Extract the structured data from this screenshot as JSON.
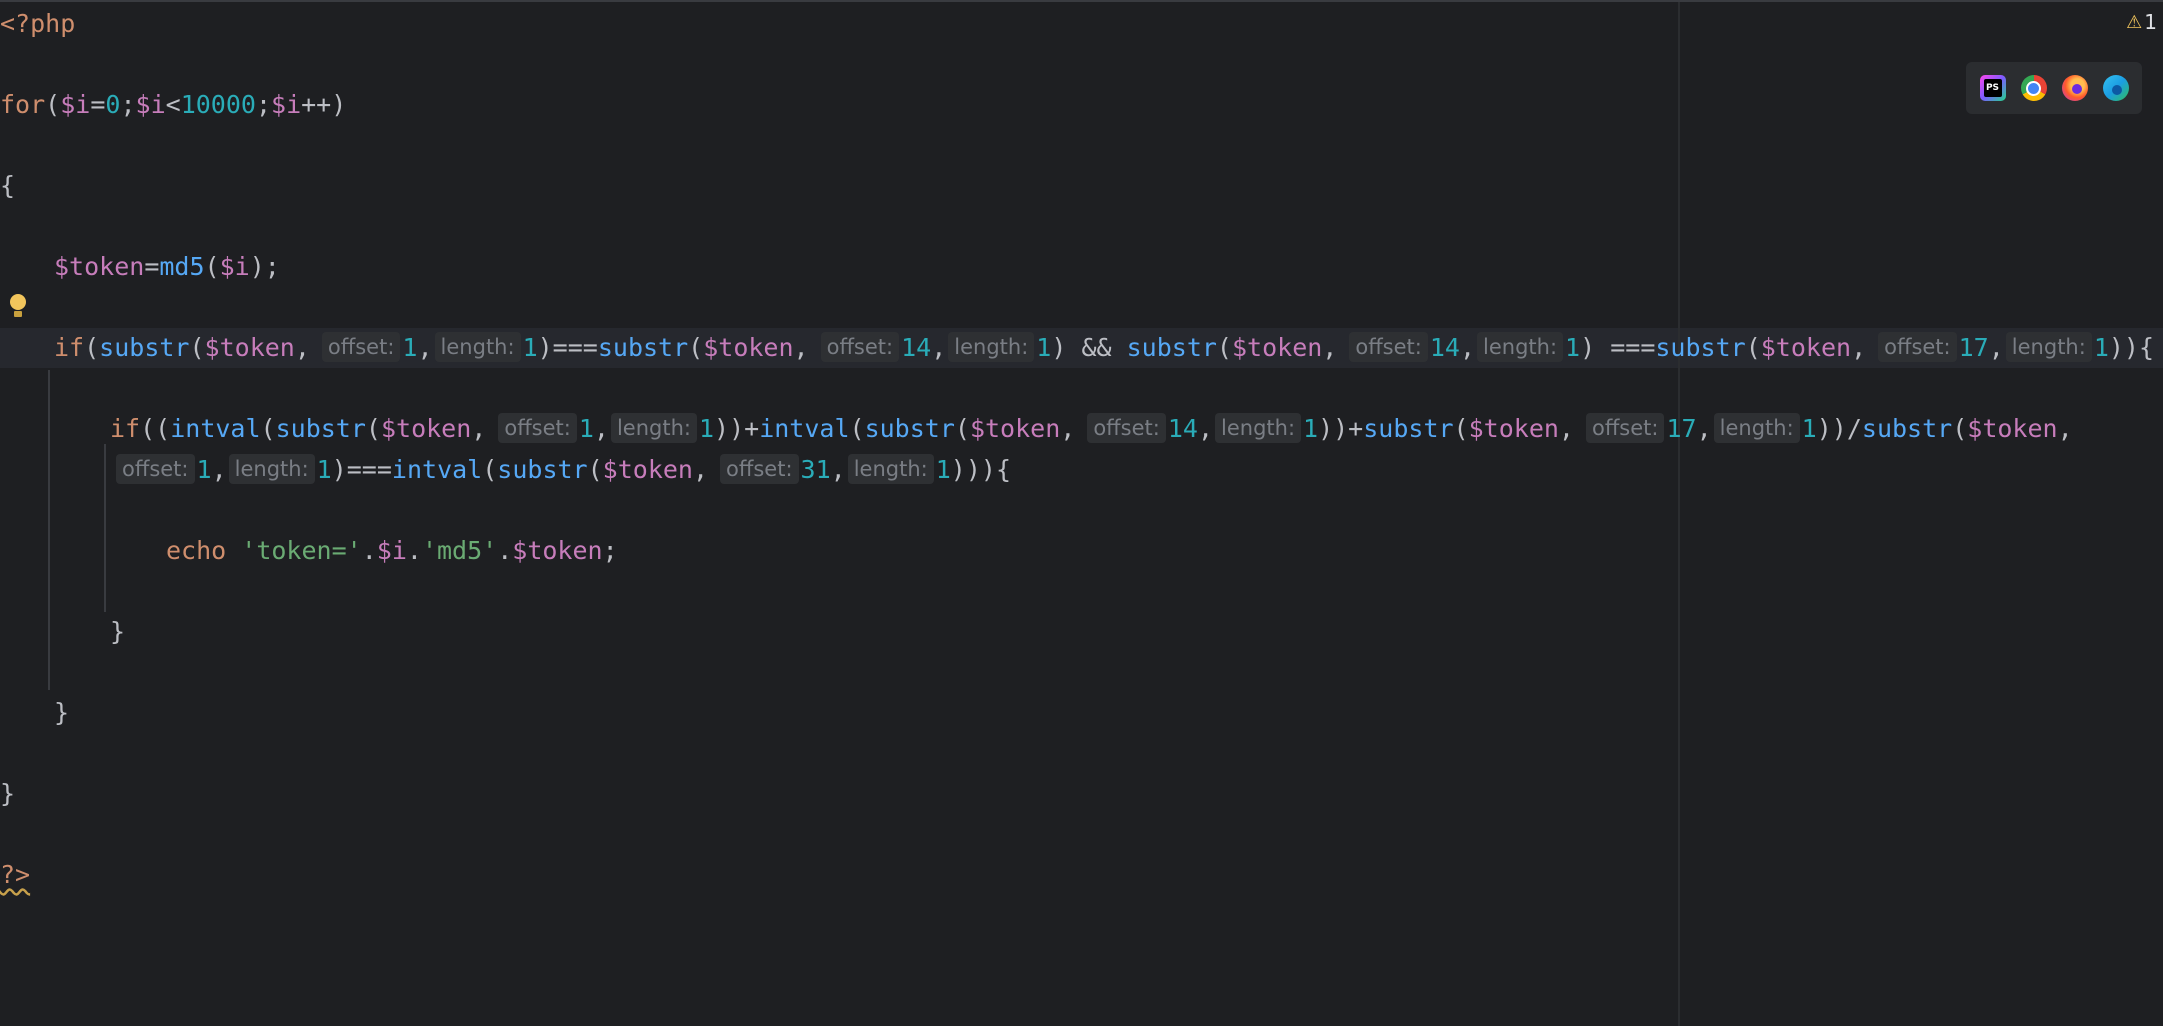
{
  "editor": {
    "language": "php",
    "warning_count": "1",
    "hint_offset": "offset:",
    "hint_length": "length:"
  },
  "browsers": [
    {
      "name": "phpstorm-icon",
      "label": "PS"
    },
    {
      "name": "chrome-icon"
    },
    {
      "name": "firefox-icon"
    },
    {
      "name": "edge-icon"
    }
  ],
  "code": {
    "open_tag": "<?php",
    "for_kw": "for",
    "i": "$i",
    "zero": "0",
    "limit": "10000",
    "brace_open": "{",
    "brace_close": "}",
    "token": "$token",
    "md5": "md5",
    "if_kw": "if",
    "substr": "substr",
    "intval": "intval",
    "echo_kw": "echo",
    "str_token": "'token='",
    "str_md5": "'md5'",
    "n1": "1",
    "n14": "14",
    "n17": "17",
    "n31": "31",
    "close_tag": "?>"
  },
  "colors": {
    "background": "#1e1f22",
    "keyword": "#cf8e6d",
    "variable": "#c77dbb",
    "function": "#56a8f5",
    "number": "#2aacb8",
    "string": "#6aab73",
    "text": "#bcbec4"
  }
}
